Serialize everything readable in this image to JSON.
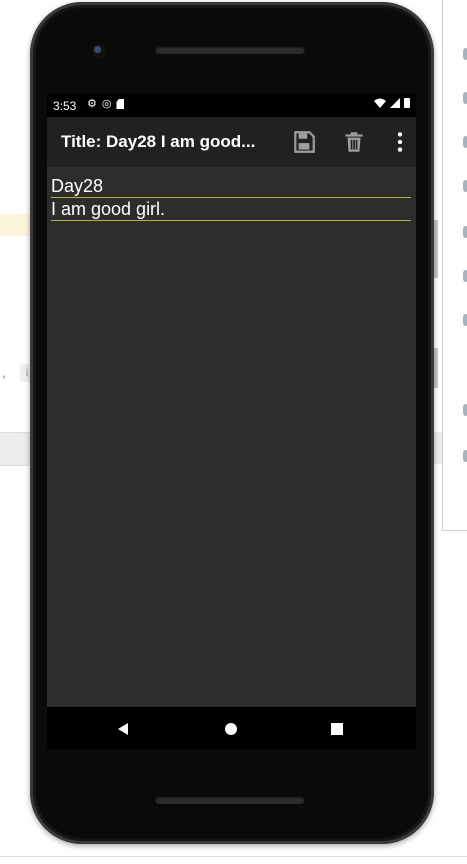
{
  "status_bar": {
    "time": "3:53",
    "icons_left": [
      "settings-icon",
      "sync-icon",
      "sd-card-icon"
    ],
    "icons_right": [
      "wifi-icon",
      "signal-icon",
      "battery-icon"
    ]
  },
  "app_bar": {
    "title": "Title: Day28 I am  good...",
    "actions": [
      "save-icon",
      "delete-icon",
      "more-vert-icon"
    ]
  },
  "note": {
    "lines": [
      "Day28",
      "I am  good girl."
    ]
  },
  "nav": {
    "buttons": [
      "back",
      "home",
      "recents"
    ]
  },
  "colors": {
    "app_bar": "#212121",
    "content_bg": "#2d2d2d",
    "line_underline": "#b7b04a",
    "icon_tint": "#9e9e9e"
  }
}
